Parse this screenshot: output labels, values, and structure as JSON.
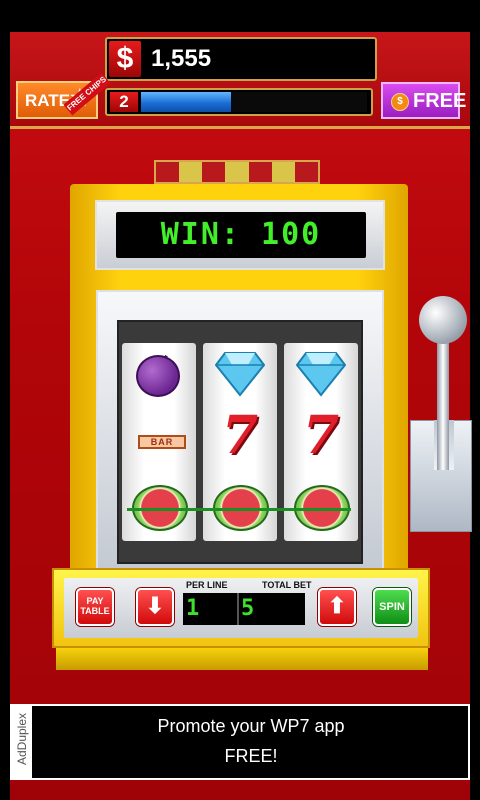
{
  "header": {
    "credits_symbol": "$",
    "credits": "1,555",
    "rate_label": "RATE",
    "rate_ribbon": "FREE CHIPS",
    "level": "2",
    "xp_progress": 0.4,
    "free_label": "FREE",
    "free_coin_symbol": "$"
  },
  "display": {
    "win_text": "WIN: 100"
  },
  "reels": [
    [
      "plum",
      "bar",
      "watermelon"
    ],
    [
      "diamond",
      "seven",
      "watermelon"
    ],
    [
      "diamond",
      "seven",
      "watermelon"
    ]
  ],
  "symbols": {
    "bar_text": "BAR",
    "seven_text": "7"
  },
  "controls": {
    "paytable_label_1": "PAY",
    "paytable_label_2": "TABLE",
    "per_line_label": "PER LINE",
    "total_bet_label": "TOTAL BET",
    "per_line": "1",
    "total_bet": "5",
    "spin_label": "SPIN",
    "down_arrow": "⬇",
    "up_arrow": "⬆"
  },
  "ad": {
    "provider": "AdDuplex",
    "line1": "Promote your WP7 app",
    "line2": "FREE!"
  },
  "colors": {
    "lights": [
      "#b8191c",
      "#d8c54a",
      "#b8191c",
      "#d8c54a",
      "#b8191c",
      "#d8c54a",
      "#b8191c"
    ]
  }
}
